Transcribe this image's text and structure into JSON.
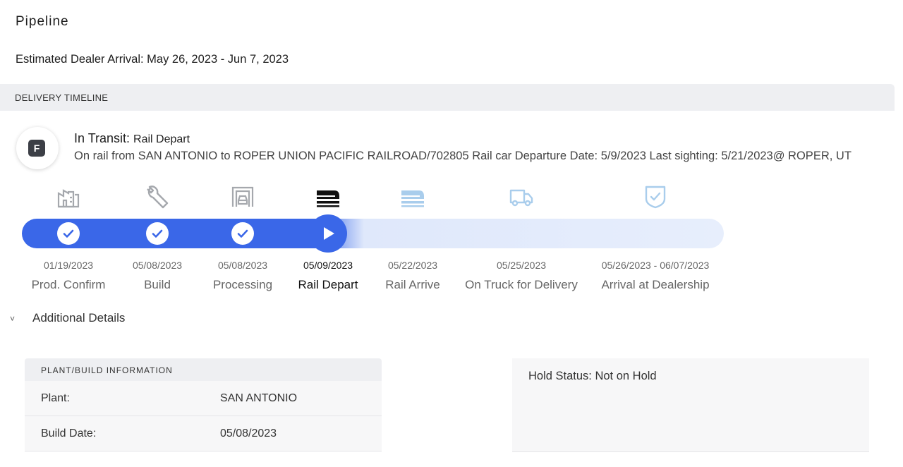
{
  "page": {
    "title": "Pipeline",
    "estimated_arrival": "Estimated Dealer Arrival: May 26, 2023 - Jun 7, 2023"
  },
  "delivery_timeline": {
    "header": "DELIVERY TIMELINE",
    "avatar_letter": "F",
    "status_label": "In Transit: ",
    "status_value": "Rail Depart",
    "status_detail": "On rail from SAN ANTONIO to ROPER UNION PACIFIC RAILROAD/702805 Rail car Departure Date: 5/9/2023 Last sighting: 5/21/2023@ ROPER, UT",
    "progress_color": "#3a67e8",
    "steps": [
      {
        "label": "Prod. Confirm",
        "date": "01/19/2023",
        "state": "done",
        "icon": "factory-icon"
      },
      {
        "label": "Build",
        "date": "05/08/2023",
        "state": "done",
        "icon": "wrench-icon"
      },
      {
        "label": "Processing",
        "date": "05/08/2023",
        "state": "done",
        "icon": "car-garage-icon"
      },
      {
        "label": "Rail Depart",
        "date": "05/09/2023",
        "state": "current",
        "icon": "train-icon"
      },
      {
        "label": "Rail Arrive",
        "date": "05/22/2023",
        "state": "pending",
        "icon": "train-icon"
      },
      {
        "label": "On Truck for Delivery",
        "date": "05/25/2023",
        "state": "pending",
        "icon": "truck-icon"
      },
      {
        "label": "Arrival at Dealership",
        "date": "05/26/2023 - 06/07/2023",
        "state": "pending",
        "icon": "shield-check-icon"
      }
    ]
  },
  "additional_details": {
    "toggle_label": "Additional Details",
    "plant_info": {
      "header": "PLANT/BUILD INFORMATION",
      "rows": [
        {
          "key": "Plant:",
          "value": "SAN ANTONIO"
        },
        {
          "key": "Build Date:",
          "value": "05/08/2023"
        }
      ]
    },
    "hold_status": "Hold Status: Not on Hold"
  }
}
